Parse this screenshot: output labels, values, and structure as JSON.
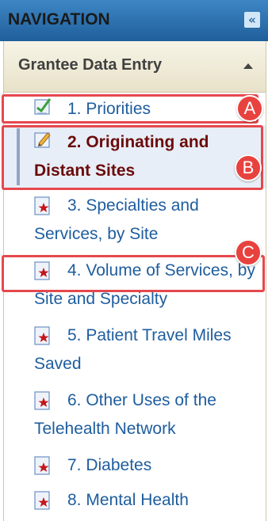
{
  "navigation": {
    "title": "NAVIGATION",
    "collapse_icon": "double-chevron-left-icon",
    "collapse_glyph": "«"
  },
  "section": {
    "title": "Grantee Data Entry",
    "toggle_icon": "triangle-up-icon"
  },
  "items": [
    {
      "label": "1. Priorities",
      "icon": "checked-document-icon",
      "selected": false
    },
    {
      "label": "2. Originating and Distant Sites",
      "icon": "edit-document-icon",
      "selected": true
    },
    {
      "label": "3. Specialties and Services, by Site",
      "icon": "starred-document-icon",
      "selected": false
    },
    {
      "label": "4. Volume of Services, by Site and Specialty",
      "icon": "starred-document-icon",
      "selected": false
    },
    {
      "label": "5. Patient Travel Miles Saved",
      "icon": "starred-document-icon",
      "selected": false
    },
    {
      "label": "6. Other Uses of the Telehealth Network",
      "icon": "starred-document-icon",
      "selected": false
    },
    {
      "label": "7. Diabetes",
      "icon": "starred-document-icon",
      "selected": false
    },
    {
      "label": "8. Mental Health",
      "icon": "starred-document-icon",
      "selected": false
    }
  ],
  "callouts": [
    {
      "label": "A",
      "color": "#e5484d"
    },
    {
      "label": "B",
      "color": "#e5484d"
    },
    {
      "label": "C",
      "color": "#e5484d"
    }
  ],
  "colors": {
    "header_blue": "#2f75b5",
    "link_blue": "#1e5d9e",
    "selected_text": "#6b0b0b",
    "selected_bg": "#e8eef7",
    "callout_red": "#e5484d"
  }
}
